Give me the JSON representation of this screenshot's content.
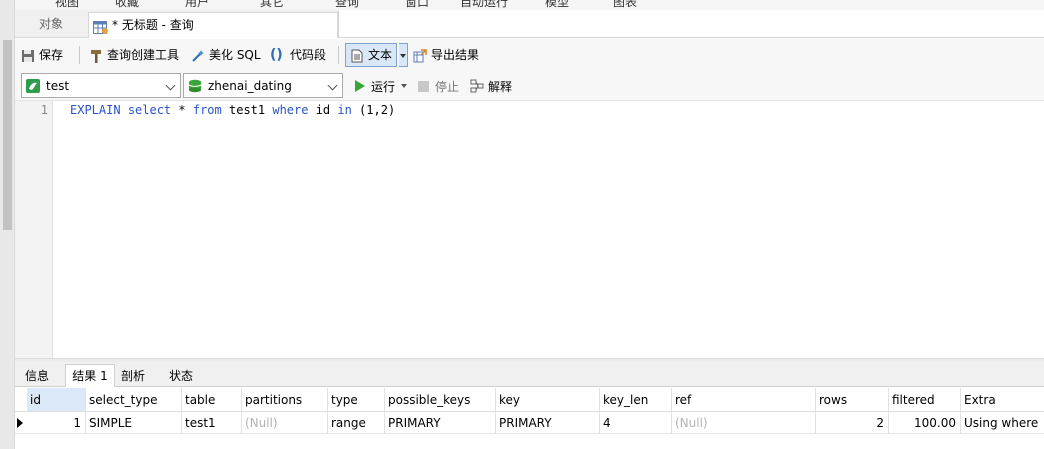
{
  "menubar": {
    "items": [
      "视图",
      "收藏",
      "用户",
      "其它",
      "查询",
      "窗口",
      "自动运行",
      "模型",
      "图表"
    ]
  },
  "tabs": {
    "objects": "对象",
    "query": "* 无标题 - 查询"
  },
  "toolbar": {
    "save": "保存",
    "query_builder": "查询创建工具",
    "beautify": "美化 SQL",
    "snippet": "代码段",
    "text": "文本",
    "export": "导出结果"
  },
  "connection": {
    "conn_name": "test",
    "database": "zhenai_dating",
    "run": "运行",
    "stop": "停止",
    "explain": "解释"
  },
  "editor": {
    "line_number": "1",
    "tokens": {
      "explain": "EXPLAIN",
      "select": "select",
      "star": " * ",
      "from": "from",
      "table": " test1 ",
      "where": "where",
      "col": " id ",
      "in": "in",
      "values": " (1,2)"
    }
  },
  "result_tabs": [
    "信息",
    "结果 1",
    "剖析",
    "状态"
  ],
  "grid": {
    "columns": [
      "id",
      "select_type",
      "table",
      "partitions",
      "type",
      "possible_keys",
      "key",
      "key_len",
      "ref",
      "rows",
      "filtered",
      "Extra"
    ],
    "rows": [
      [
        "1",
        "SIMPLE",
        "test1",
        "(Null)",
        "range",
        "PRIMARY",
        "PRIMARY",
        "4",
        "(Null)",
        "2",
        "100.00",
        "Using where"
      ]
    ]
  },
  "colors": {
    "keyword": "#2a55c9",
    "run_green": "#3aa63a",
    "selected_tab": "#d9e7f6",
    "null_text": "#b3b3b3"
  }
}
